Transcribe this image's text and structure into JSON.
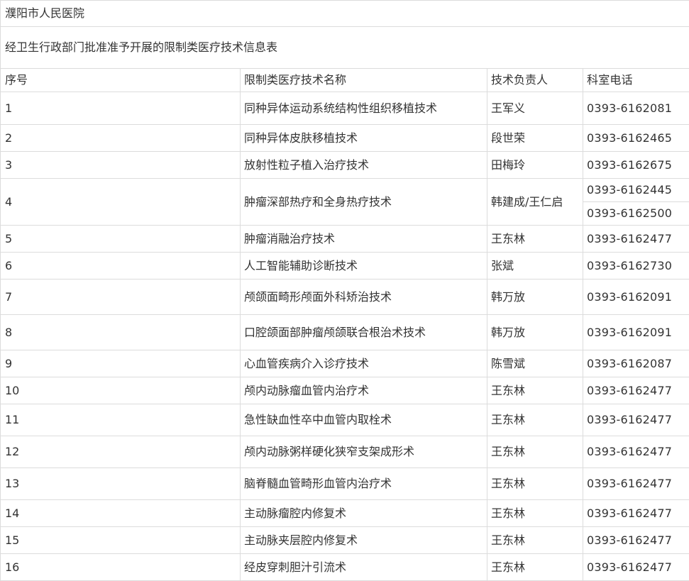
{
  "document": {
    "hospital": "濮阳市人民医院",
    "table_title": "经卫生行政部门批准准予开展的限制类医疗技术信息表"
  },
  "columns": {
    "index": "序号",
    "tech": "限制类医疗技术名称",
    "lead": "技术负责人",
    "phone": "科室电话"
  },
  "rows": [
    {
      "index": "1",
      "tech": "同种异体运动系统结构性组织移植技术",
      "lead": "王军义",
      "phones": [
        "0393-6162081"
      ]
    },
    {
      "index": "2",
      "tech": "同种异体皮肤移植技术",
      "lead": "段世荣",
      "phones": [
        "0393-6162465"
      ]
    },
    {
      "index": "3",
      "tech": "放射性粒子植入治疗技术",
      "lead": "田梅玲",
      "phones": [
        "0393-6162675"
      ]
    },
    {
      "index": "4",
      "tech": "肿瘤深部热疗和全身热疗技术",
      "lead": "韩建成/王仁启",
      "phones": [
        "0393-6162445",
        "0393-6162500"
      ]
    },
    {
      "index": "5",
      "tech": "肿瘤消融治疗技术",
      "lead": "王东林",
      "phones": [
        "0393-6162477"
      ]
    },
    {
      "index": "6",
      "tech": "人工智能辅助诊断技术",
      "lead": "张斌",
      "phones": [
        "0393-6162730"
      ]
    },
    {
      "index": "7",
      "tech": "颅颌面畸形颅面外科矫治技术",
      "lead": "韩万放",
      "phones": [
        "0393-6162091"
      ]
    },
    {
      "index": "8",
      "tech": "口腔颌面部肿瘤颅颌联合根治术技术",
      "lead": "韩万放",
      "phones": [
        "0393-6162091"
      ]
    },
    {
      "index": "9",
      "tech": "心血管疾病介入诊疗技术",
      "lead": "陈雪斌",
      "phones": [
        "0393-6162087"
      ]
    },
    {
      "index": "10",
      "tech": "颅内动脉瘤血管内治疗术",
      "lead": "王东林",
      "phones": [
        "0393-6162477"
      ]
    },
    {
      "index": "11",
      "tech": "急性缺血性卒中血管内取栓术",
      "lead": "王东林",
      "phones": [
        "0393-6162477"
      ]
    },
    {
      "index": "12",
      "tech": "颅内动脉粥样硬化狭窄支架成形术",
      "lead": "王东林",
      "phones": [
        "0393-6162477"
      ]
    },
    {
      "index": "13",
      "tech": "脑脊髓血管畸形血管内治疗术",
      "lead": "王东林",
      "phones": [
        "0393-6162477"
      ]
    },
    {
      "index": "14",
      "tech": "主动脉瘤腔内修复术",
      "lead": "王东林",
      "phones": [
        "0393-6162477"
      ]
    },
    {
      "index": "15",
      "tech": "主动脉夹层腔内修复术",
      "lead": "王东林",
      "phones": [
        "0393-6162477"
      ]
    },
    {
      "index": "16",
      "tech": "经皮穿刺胆汁引流术",
      "lead": "王东林",
      "phones": [
        "0393-6162477"
      ]
    }
  ]
}
